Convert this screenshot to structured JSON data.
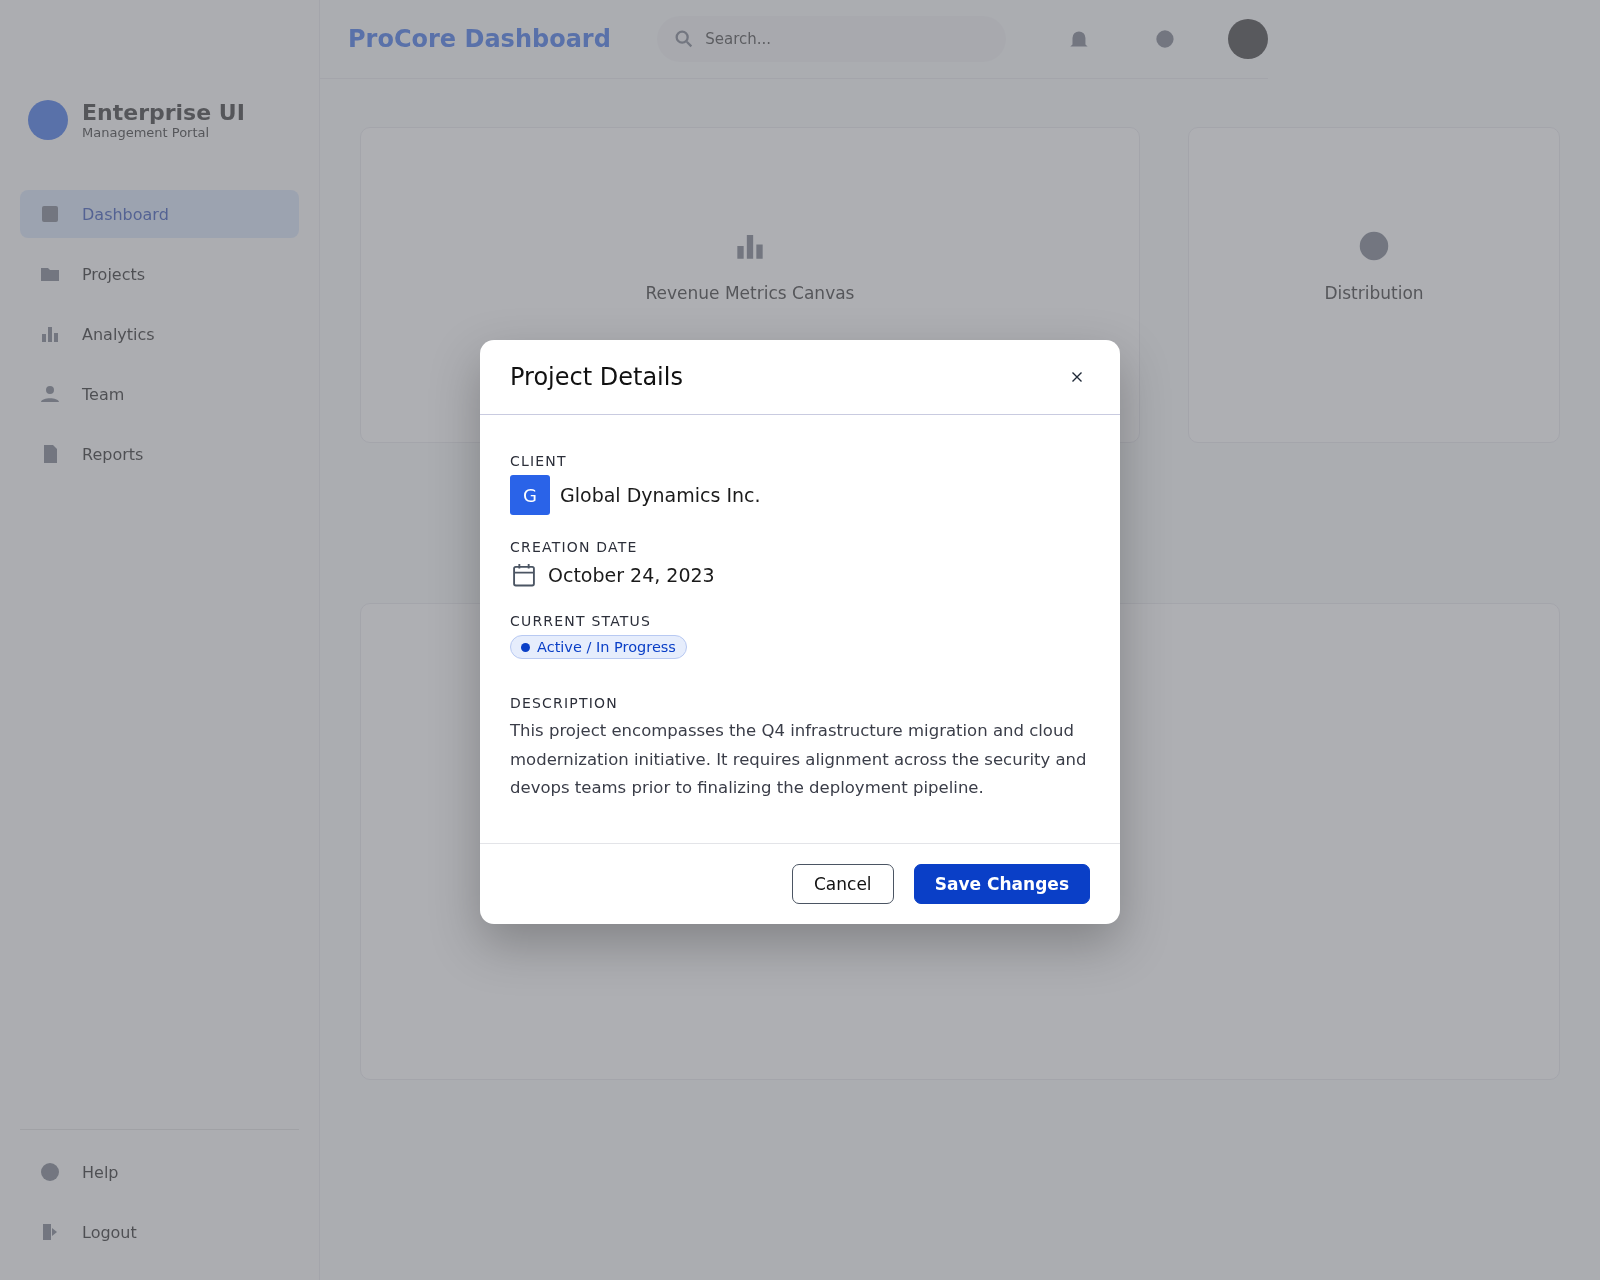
{
  "header": {
    "title": "ProCore Dashboard",
    "search": {
      "placeholder": "Search..."
    }
  },
  "sidebar": {
    "brand": {
      "name": "Enterprise UI",
      "subtitle": "Management Portal"
    },
    "items": [
      {
        "label": "Dashboard",
        "selected": true
      },
      {
        "label": "Projects",
        "selected": false
      },
      {
        "label": "Analytics",
        "selected": false
      },
      {
        "label": "Team",
        "selected": false
      },
      {
        "label": "Reports",
        "selected": false
      }
    ],
    "footer_items": [
      {
        "label": "Help"
      },
      {
        "label": "Logout"
      }
    ]
  },
  "cards": [
    {
      "label": "Revenue Metrics Canvas"
    },
    {
      "label": "Distribution"
    }
  ],
  "dialog": {
    "title": "Project Details",
    "client": {
      "label": "CLIENT",
      "initial": "G",
      "name": "Global Dynamics Inc."
    },
    "creation_date": {
      "label": "CREATION DATE",
      "value": "October 24, 2023"
    },
    "status": {
      "label": "CURRENT STATUS",
      "value": "Active / In Progress",
      "color": "#0a3fc7"
    },
    "description": {
      "label": "DESCRIPTION",
      "text": "This project encompasses the Q4 infrastructure migration and cloud modernization initiative. It requires alignment across the security and devops teams prior to finalizing the deployment pipeline."
    },
    "buttons": [
      {
        "label": "Cancel",
        "kind": "secondary"
      },
      {
        "label": "Save Changes",
        "kind": "primary"
      }
    ]
  }
}
